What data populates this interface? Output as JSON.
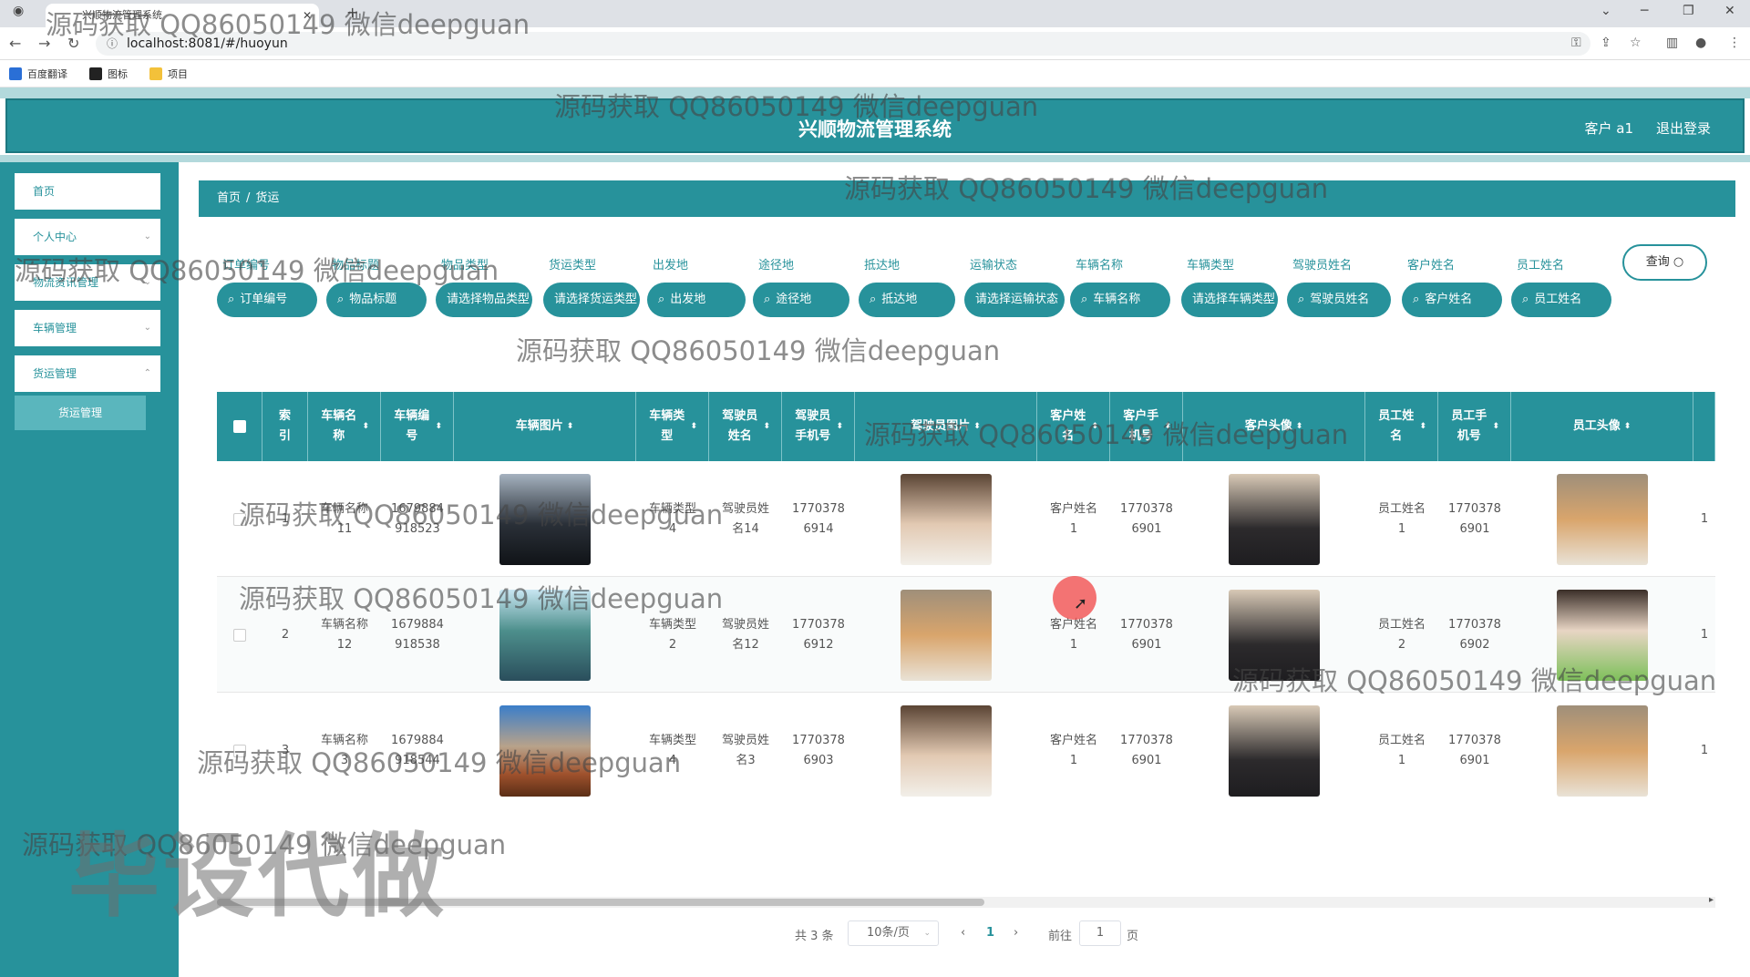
{
  "browser": {
    "tab_title": "兴顺物流管理系统",
    "url": "localhost:8081/#/huoyun",
    "bookmarks": [
      "百度翻译",
      "图标",
      "项目"
    ]
  },
  "header": {
    "title": "兴顺物流管理系统",
    "user": "客户 a1",
    "logout": "退出登录"
  },
  "sidebar": {
    "items": [
      {
        "label": "首页"
      },
      {
        "label": "个人中心"
      },
      {
        "label": "物流资讯管理"
      },
      {
        "label": "车辆管理"
      },
      {
        "label": "货运管理"
      }
    ],
    "active_sub": "货运管理"
  },
  "breadcrumb": {
    "home": "首页",
    "sep": "/",
    "current": "货运"
  },
  "filters": {
    "labels": [
      "订单编号",
      "物品标题",
      "物品类型",
      "货运类型",
      "出发地",
      "途径地",
      "抵达地",
      "运输状态",
      "车辆名称",
      "车辆类型",
      "驾驶员姓名",
      "客户姓名",
      "员工姓名"
    ],
    "placeholders": [
      "订单编号",
      "物品标题",
      "请选择物品类型",
      "请选择货运类型",
      "出发地",
      "途径地",
      "抵达地",
      "请选择运输状态",
      "车辆名称",
      "请选择车辆类型",
      "驾驶员姓名",
      "客户姓名",
      "员工姓名"
    ],
    "search_button": "查询"
  },
  "table": {
    "headers": [
      "索引",
      "车辆名称",
      "车辆编号",
      "车辆图片",
      "车辆类型",
      "驾驶员姓名",
      "驾驶员手机号",
      "驾驶员图片",
      "客户姓名",
      "客户手机号",
      "客户头像",
      "员工姓名",
      "员工手机号",
      "员工头像"
    ],
    "rows": [
      {
        "index": "1",
        "vehicle_name": "车辆名称11",
        "vehicle_no": "1679884918523",
        "vehicle_type": "车辆类型4",
        "driver_name": "驾驶员姓名14",
        "driver_phone": "17703786914",
        "customer_name": "客户姓名1",
        "customer_phone": "17703786901",
        "staff_name": "员工姓名1",
        "staff_phone": "17703786901"
      },
      {
        "index": "2",
        "vehicle_name": "车辆名称12",
        "vehicle_no": "1679884918538",
        "vehicle_type": "车辆类型2",
        "driver_name": "驾驶员姓名12",
        "driver_phone": "17703786912",
        "customer_name": "客户姓名1",
        "customer_phone": "17703786901",
        "staff_name": "员工姓名2",
        "staff_phone": "17703786902"
      },
      {
        "index": "3",
        "vehicle_name": "车辆名称3",
        "vehicle_no": "1679884918544",
        "vehicle_type": "车辆类型4",
        "driver_name": "驾驶员姓名3",
        "driver_phone": "17703786903",
        "customer_name": "客户姓名1",
        "customer_phone": "17703786901",
        "staff_name": "员工姓名1",
        "staff_phone": "17703786901"
      }
    ]
  },
  "pagination": {
    "total": "共 3 条",
    "page_size": "10条/页",
    "current": "1",
    "goto_label": "前往",
    "goto_value": "1",
    "page_unit": "页"
  },
  "watermark": {
    "text": "源码获取 QQ86050149 微信deepguan",
    "big": "毕设代做"
  },
  "colors": {
    "primary": "#27929b",
    "light": "#b3d9dc",
    "active": "#5ab6bd"
  }
}
